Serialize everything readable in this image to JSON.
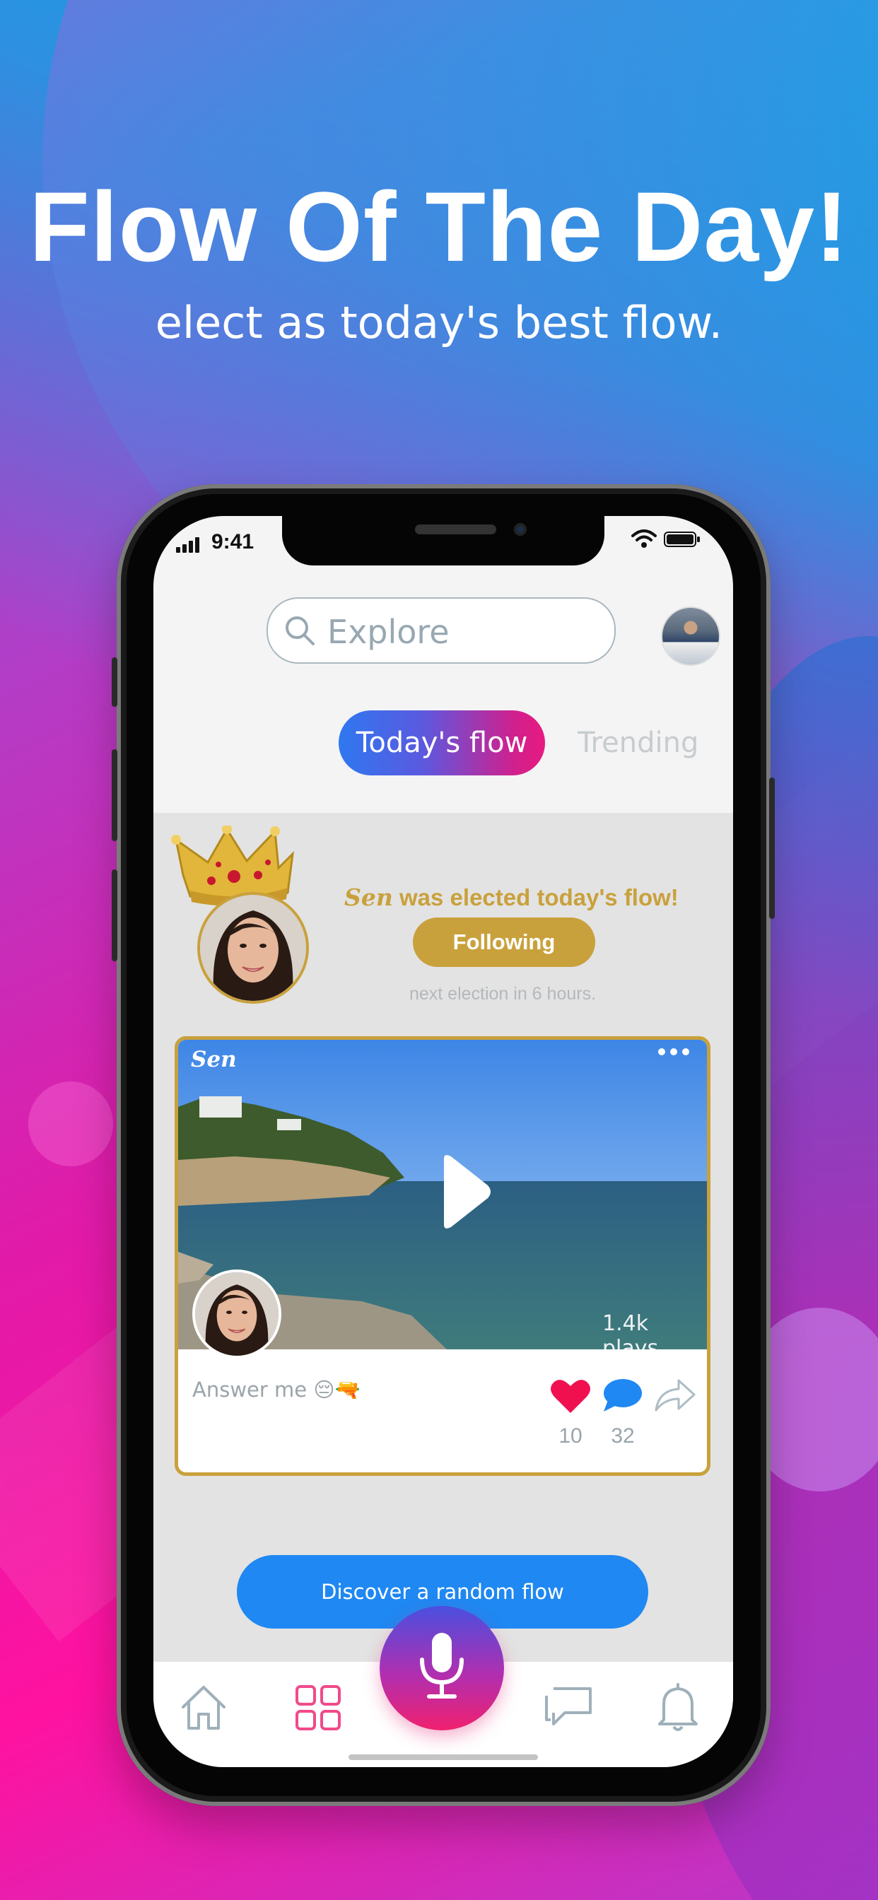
{
  "promo": {
    "headline": "Flow Of The Day!",
    "subline": "elect as today's best flow."
  },
  "status_bar": {
    "time": "9:41"
  },
  "search": {
    "placeholder": "Explore"
  },
  "tabs": [
    {
      "label": "Today's flow",
      "active": true
    },
    {
      "label": "Trending",
      "active": false
    }
  ],
  "winner": {
    "name": "Sen",
    "elected_text": "was elected today's flow!",
    "follow_label": "Following",
    "next_election": "next election in 6 hours."
  },
  "post": {
    "user": "Sen",
    "plays": "1.4k plays",
    "caption": "Answer me 😔🔫",
    "likes": "10",
    "comments": "32"
  },
  "discover": {
    "label": "Discover a random flow"
  },
  "bottom_nav": [
    {
      "icon": "home-icon"
    },
    {
      "icon": "grid-icon"
    },
    {
      "icon": "microphone-icon"
    },
    {
      "icon": "chat-icon"
    },
    {
      "icon": "bell-icon"
    }
  ],
  "colors": {
    "gold": "#c9a13c",
    "blue": "#1f88f2",
    "pink": "#e81a80",
    "heart": "#f0104f"
  }
}
